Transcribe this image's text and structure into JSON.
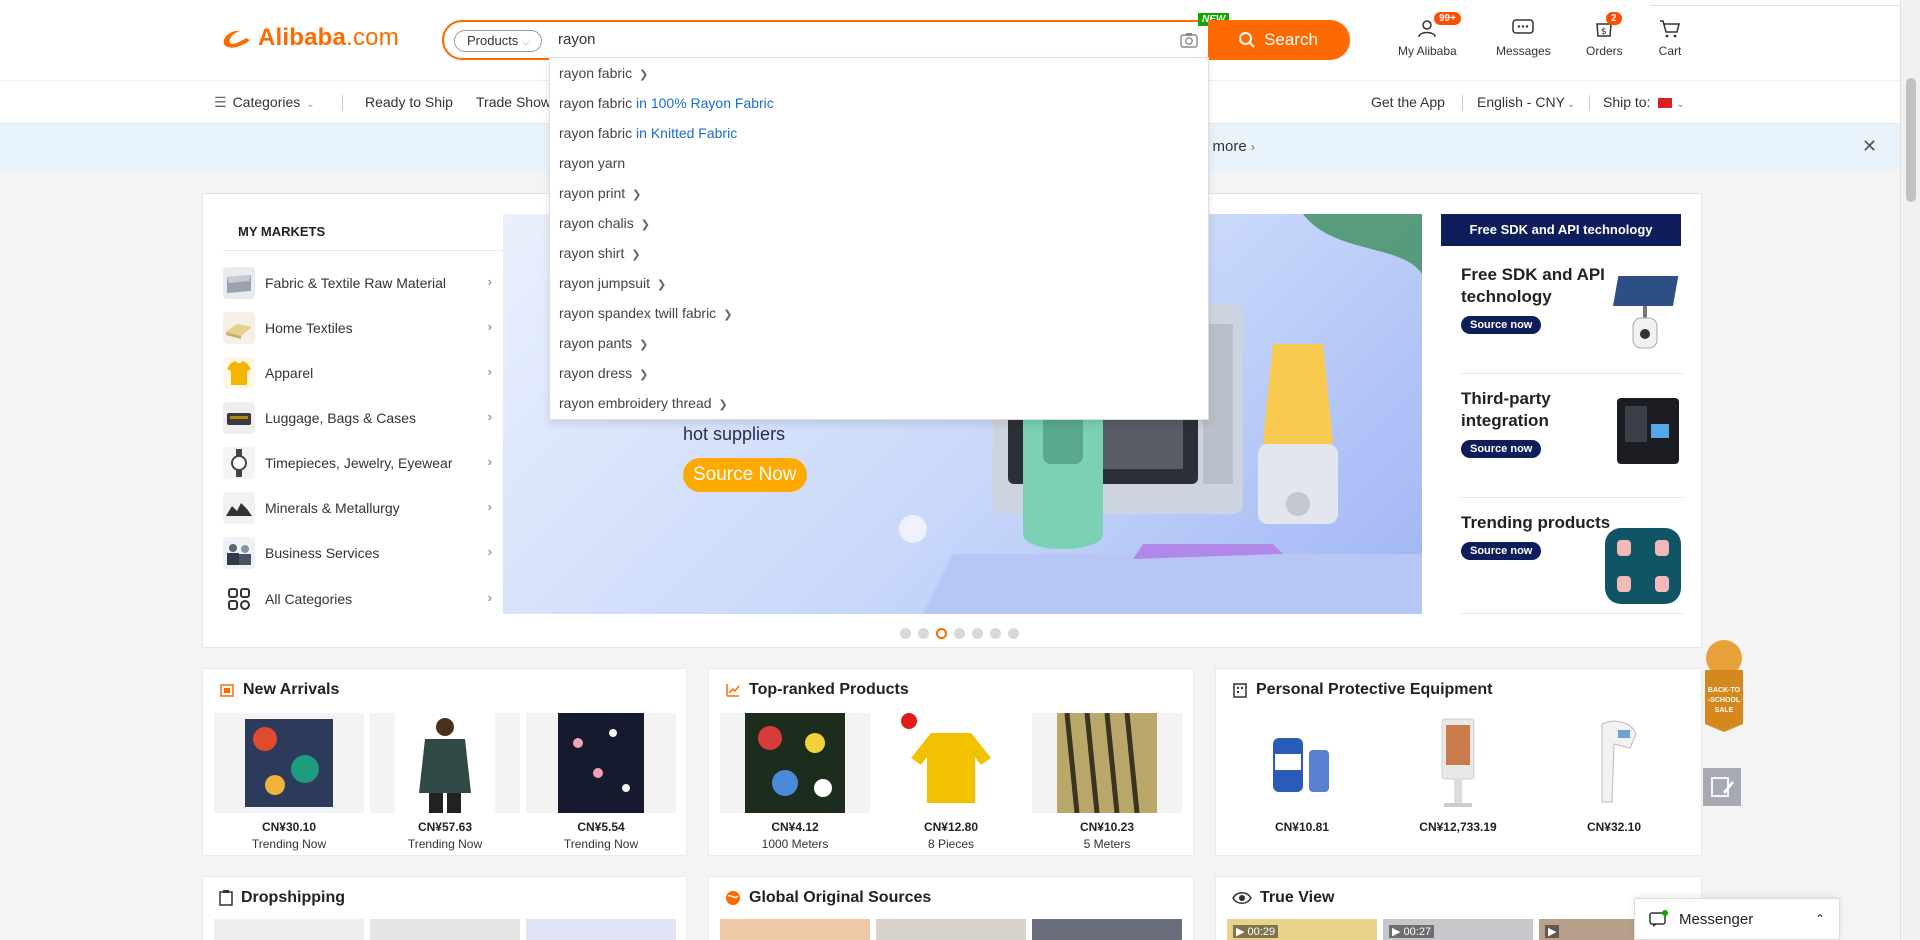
{
  "header": {
    "logo": {
      "brand": "Alibaba",
      "tld": ".com"
    },
    "search": {
      "category": "Products",
      "query": "rayon",
      "new_badge": "NEW",
      "button": "Search"
    },
    "items": [
      {
        "label": "My Alibaba",
        "badge": "99+"
      },
      {
        "label": "Messages",
        "badge": ""
      },
      {
        "label": "Orders",
        "badge": "2"
      },
      {
        "label": "Cart",
        "badge": ""
      }
    ]
  },
  "nav": {
    "categories": "Categories",
    "ready_to_ship": "Ready to Ship",
    "trade_shows": "Trade Show",
    "get_app": "Get the App",
    "language": "English - CNY",
    "ship_to": "Ship to:"
  },
  "notice": {
    "more": "n more"
  },
  "suggestions": [
    {
      "term": "rayon fabric",
      "category": "",
      "chevron": true
    },
    {
      "term": "rayon fabric",
      "category": "in 100% Rayon Fabric",
      "chevron": false
    },
    {
      "term": "rayon fabric",
      "category": "in Knitted Fabric",
      "chevron": false
    },
    {
      "term": "rayon yarn",
      "category": "",
      "chevron": false
    },
    {
      "term": "rayon print",
      "category": "",
      "chevron": true
    },
    {
      "term": "rayon chalis",
      "category": "",
      "chevron": true
    },
    {
      "term": "rayon shirt",
      "category": "",
      "chevron": true
    },
    {
      "term": "rayon jumpsuit",
      "category": "",
      "chevron": true
    },
    {
      "term": "rayon spandex twill fabric",
      "category": "",
      "chevron": true
    },
    {
      "term": "rayon pants",
      "category": "",
      "chevron": true
    },
    {
      "term": "rayon dress",
      "category": "",
      "chevron": true
    },
    {
      "term": "rayon embroidery thread",
      "category": "",
      "chevron": true
    }
  ],
  "markets": {
    "title": "MY MARKETS",
    "items": [
      "Fabric & Textile Raw Material",
      "Home Textiles",
      "Apparel",
      "Luggage, Bags & Cases",
      "Timepieces, Jewelry, Eyewear",
      "Minerals & Metallurgy",
      "Business Services",
      "All Categories"
    ]
  },
  "banner": {
    "subtitle": "hot suppliers",
    "button": "Source Now",
    "slide_count": 7,
    "active_slide": 3
  },
  "sdk": {
    "header": "Free SDK and API technology",
    "blocks": [
      {
        "title": "Free SDK and API technology",
        "button": "Source now"
      },
      {
        "title": "Third-party integration",
        "button": "Source now"
      },
      {
        "title": "Trending products",
        "button": "Source now"
      }
    ]
  },
  "cards": [
    {
      "title": "New Arrivals",
      "products": [
        {
          "price": "CN¥30.10",
          "sub": "Trending Now"
        },
        {
          "price": "CN¥57.63",
          "sub": "Trending Now"
        },
        {
          "price": "CN¥5.54",
          "sub": "Trending Now"
        }
      ]
    },
    {
      "title": "Top-ranked Products",
      "products": [
        {
          "price": "CN¥4.12",
          "sub": "1000 Meters"
        },
        {
          "price": "CN¥12.80",
          "sub": "8 Pieces"
        },
        {
          "price": "CN¥10.23",
          "sub": "5 Meters"
        }
      ]
    },
    {
      "title": "Personal Protective Equipment",
      "products": [
        {
          "price": "CN¥10.81",
          "sub": ""
        },
        {
          "price": "CN¥12,733.19",
          "sub": ""
        },
        {
          "price": "CN¥32.10",
          "sub": ""
        }
      ]
    },
    {
      "title": "Dropshipping",
      "products": []
    },
    {
      "title": "Global Original Sources",
      "products": []
    },
    {
      "title": "True View",
      "products": [],
      "video_times": [
        "00:29",
        "00:27"
      ]
    }
  ],
  "side_badge": {
    "lines": [
      "BACK-TO",
      "-SCHOOL",
      "SALE"
    ]
  },
  "messenger": {
    "label": "Messenger"
  },
  "colors": {
    "brand": "#ff6a00",
    "navy": "#0e1e5b",
    "link": "#1a6dcc"
  }
}
